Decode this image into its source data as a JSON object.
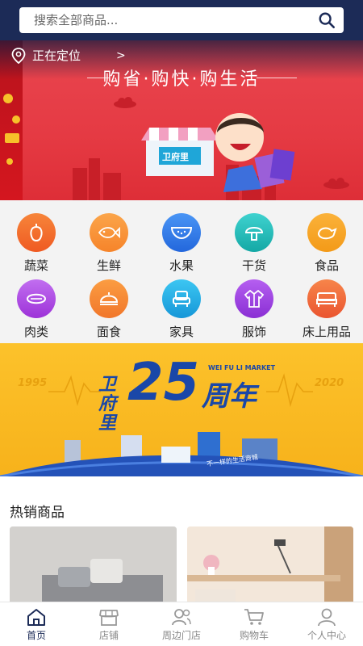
{
  "search": {
    "placeholder": "搜索全部商品..."
  },
  "banner_top": {
    "location": "正在定位",
    "location_chevron": ">",
    "slogan": "购省·购快·购生活",
    "shop_sign": "卫府里"
  },
  "categories": [
    {
      "label": "蔬菜",
      "icon": "pepper-icon",
      "color": "#f36a2a"
    },
    {
      "label": "生鲜",
      "icon": "fish-icon",
      "color": "#f8902a"
    },
    {
      "label": "水果",
      "icon": "watermelon-icon",
      "color": "#2f7de9"
    },
    {
      "label": "干货",
      "icon": "mushroom-icon",
      "color": "#1fbfbc"
    },
    {
      "label": "食品",
      "icon": "chicken-icon",
      "color": "#f7a323"
    },
    {
      "label": "肉类",
      "icon": "meat-icon",
      "color": "#b24de0"
    },
    {
      "label": "面食",
      "icon": "bun-icon",
      "color": "#f48a2a"
    },
    {
      "label": "家具",
      "icon": "armchair-icon",
      "color": "#1fb1e8"
    },
    {
      "label": "服饰",
      "icon": "jacket-icon",
      "color": "#9b3ee0"
    },
    {
      "label": "床上用品",
      "icon": "bed-icon",
      "color": "#f0673d"
    }
  ],
  "banner_anniv": {
    "brand": "卫府里",
    "number": "25",
    "word": "周年",
    "english": "WEI FU LI MARKET",
    "year_start": "1995",
    "year_end": "2020",
    "tagline": "不一样的生活商城"
  },
  "hot": {
    "title": "热销商品"
  },
  "tabbar": [
    {
      "label": "首页",
      "icon": "home-icon",
      "active": true
    },
    {
      "label": "店铺",
      "icon": "store-icon",
      "active": false
    },
    {
      "label": "周边门店",
      "icon": "nearby-icon",
      "active": false
    },
    {
      "label": "购物车",
      "icon": "cart-icon",
      "active": false
    },
    {
      "label": "个人中心",
      "icon": "user-icon",
      "active": false
    }
  ],
  "colors": {
    "header": "#1c2b57",
    "banner_red": "#e53a43",
    "banner_yellow": "#fcc22b",
    "brand_blue": "#1a47a8"
  }
}
